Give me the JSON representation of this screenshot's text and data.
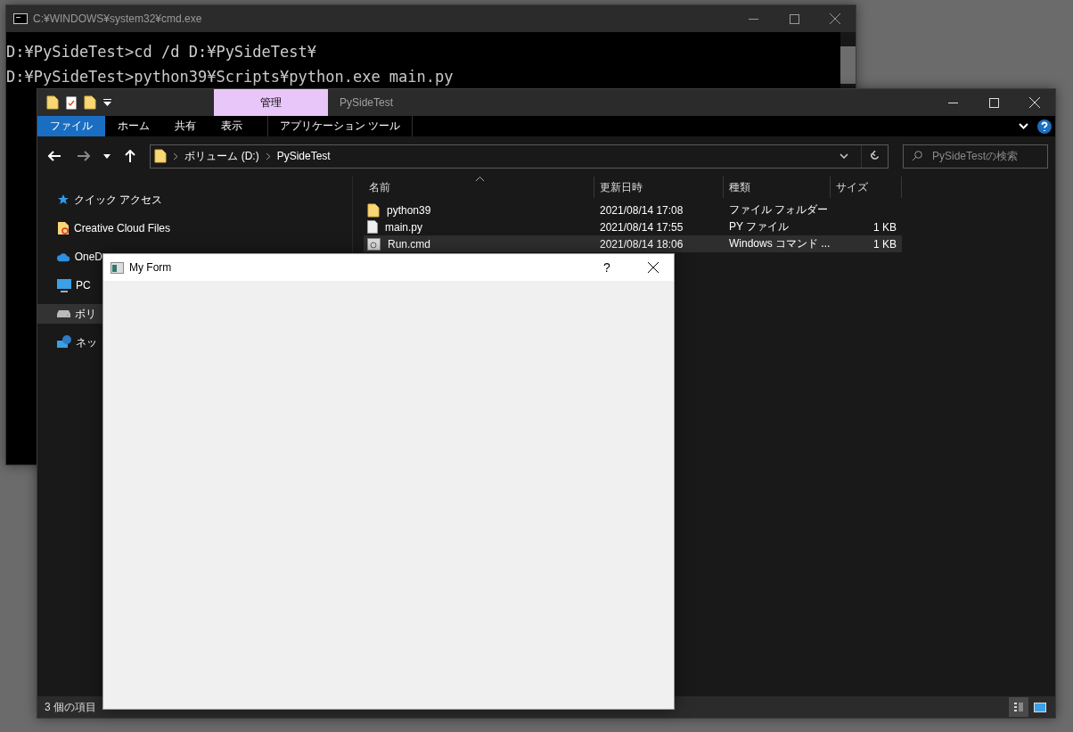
{
  "cmd_window": {
    "title": "C:¥WINDOWS¥system32¥cmd.exe",
    "lines": [
      "D:¥PySideTest>cd /d D:¥PySideTest¥",
      "D:¥PySideTest>python39¥Scripts¥python.exe main.py"
    ]
  },
  "explorer": {
    "context_tab": "管理",
    "title": "PySideTest",
    "ribbon_tabs": [
      {
        "label": "ファイル",
        "selected": true
      },
      {
        "label": "ホーム",
        "selected": false
      },
      {
        "label": "共有",
        "selected": false
      },
      {
        "label": "表示",
        "selected": false
      },
      {
        "label": "アプリケーション ツール",
        "selected": false,
        "kind": "context"
      }
    ],
    "address": [
      "ボリューム (D:)",
      "PySideTest"
    ],
    "search": {
      "placeholder": "PySideTestの検索"
    },
    "nav_items": [
      {
        "label": "クイック アクセス",
        "kind": "star",
        "selected": false
      },
      {
        "label": "Creative Cloud Files",
        "kind": "ccfolder",
        "selected": false
      },
      {
        "label": "OneD",
        "kind": "cloud",
        "selected": false
      },
      {
        "label": "PC",
        "kind": "pc",
        "selected": false
      },
      {
        "label": "ボリ",
        "kind": "drive",
        "selected": true
      },
      {
        "label": "ネッ",
        "kind": "network",
        "selected": false
      }
    ],
    "columns": [
      "名前",
      "更新日時",
      "種類",
      "サイズ"
    ],
    "rows": [
      {
        "kind": "folder",
        "name": "python39",
        "date": "2021/08/14 17:08",
        "type": "ファイル フォルダー",
        "selected": false
      },
      {
        "kind": "file",
        "name": "main.py",
        "date": "2021/08/14 17:55",
        "type": "PY ファイル",
        "size": "1 KB",
        "selected": false
      },
      {
        "kind": "cmd",
        "name": "Run.cmd",
        "date": "2021/08/14 18:06",
        "type": "Windows コマンド ...",
        "size": "1 KB",
        "selected": true
      }
    ],
    "status": "3 個の項目"
  },
  "form": {
    "title": "My Form",
    "help": "?"
  }
}
